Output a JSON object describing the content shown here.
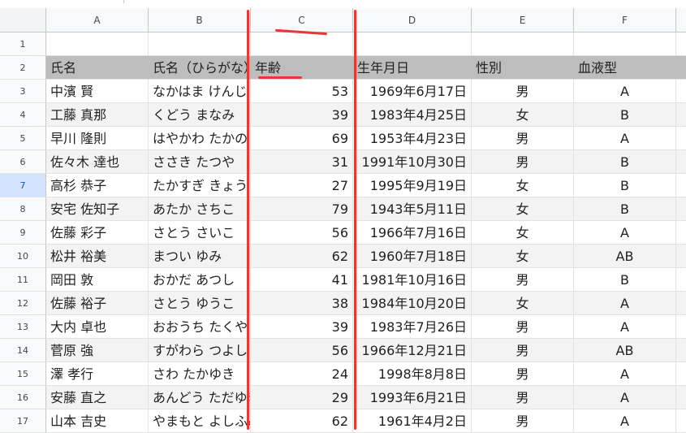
{
  "columns": [
    "A",
    "B",
    "C",
    "D",
    "E",
    "F"
  ],
  "selected_row": "7",
  "header": {
    "row_number": "2",
    "cells": [
      "氏名",
      "氏名（ひらがな）",
      "年齢",
      "生年月日",
      "性別",
      "血液型"
    ]
  },
  "blank_row": {
    "row_number": "1"
  },
  "rows": [
    {
      "row_number": "3",
      "name": "中濱 賢",
      "kana": "なかはま けんじ",
      "age": "53",
      "birth": "1969年6月17日",
      "sex": "男",
      "blood": "A"
    },
    {
      "row_number": "4",
      "name": "工藤 真那",
      "kana": "くどう まなみ",
      "age": "39",
      "birth": "1983年4月25日",
      "sex": "女",
      "blood": "B"
    },
    {
      "row_number": "5",
      "name": "早川 隆則",
      "kana": "はやかわ たかのり",
      "age": "69",
      "birth": "1953年4月23日",
      "sex": "男",
      "blood": "A"
    },
    {
      "row_number": "6",
      "name": "佐々木 達也",
      "kana": "ささき たつや",
      "age": "31",
      "birth": "1991年10月30日",
      "sex": "男",
      "blood": "B"
    },
    {
      "row_number": "7",
      "name": "高杉 恭子",
      "kana": "たかすぎ きょうこ",
      "age": "27",
      "birth": "1995年9月19日",
      "sex": "女",
      "blood": "B"
    },
    {
      "row_number": "8",
      "name": "安宅 佐知子",
      "kana": "あたか さちこ",
      "age": "79",
      "birth": "1943年5月11日",
      "sex": "女",
      "blood": "B"
    },
    {
      "row_number": "9",
      "name": "佐藤 彩子",
      "kana": "さとう さいこ",
      "age": "56",
      "birth": "1966年7月16日",
      "sex": "女",
      "blood": "A"
    },
    {
      "row_number": "10",
      "name": "松井 裕美",
      "kana": "まつい ゆみ",
      "age": "62",
      "birth": "1960年7月18日",
      "sex": "女",
      "blood": "AB"
    },
    {
      "row_number": "11",
      "name": "岡田 敦",
      "kana": "おかだ あつし",
      "age": "41",
      "birth": "1981年10月16日",
      "sex": "男",
      "blood": "B"
    },
    {
      "row_number": "12",
      "name": "佐藤 裕子",
      "kana": "さとう ゆうこ",
      "age": "38",
      "birth": "1984年10月20日",
      "sex": "女",
      "blood": "A"
    },
    {
      "row_number": "13",
      "name": "大内 卓也",
      "kana": "おおうち たくや",
      "age": "39",
      "birth": "1983年7月26日",
      "sex": "男",
      "blood": "A"
    },
    {
      "row_number": "14",
      "name": "菅原 強",
      "kana": "すがわら つよし",
      "age": "56",
      "birth": "1966年12月21日",
      "sex": "男",
      "blood": "AB"
    },
    {
      "row_number": "15",
      "name": "澤 孝行",
      "kana": "さわ たかゆき",
      "age": "24",
      "birth": "1998年8月8日",
      "sex": "男",
      "blood": "A"
    },
    {
      "row_number": "16",
      "name": "安藤 直之",
      "kana": "あんどう ただゆき",
      "age": "29",
      "birth": "1993年6月21日",
      "sex": "男",
      "blood": "A"
    },
    {
      "row_number": "17",
      "name": "山本 吉史",
      "kana": "やまもと よしふみ",
      "age": "62",
      "birth": "1961年4月2日",
      "sex": "男",
      "blood": "A"
    }
  ],
  "colors": {
    "header_fill": "#bdbdbd",
    "alt_row_fill": "#f3f3f3",
    "annotation_red": "#e53935",
    "selected_row_header": "#d3e3fd"
  }
}
